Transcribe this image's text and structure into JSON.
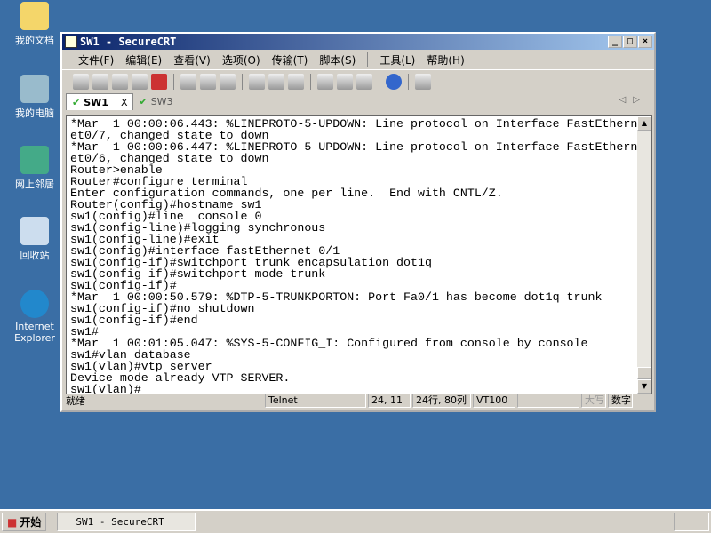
{
  "desktop": {
    "icons": [
      {
        "label": "我的文档"
      },
      {
        "label": "我的电脑"
      },
      {
        "label": "网上邻居"
      },
      {
        "label": "回收站"
      },
      {
        "label": "Internet Explorer"
      }
    ]
  },
  "window": {
    "title": "SW1 - SecureCRT",
    "menu": [
      "文件(F)",
      "编辑(E)",
      "查看(V)",
      "选项(O)",
      "传输(T)",
      "脚本(S)",
      "工具(L)",
      "帮助(H)"
    ],
    "tabs": [
      {
        "label": "SW1",
        "active": true,
        "close": "X"
      },
      {
        "label": "SW3",
        "active": false
      }
    ],
    "terminal_lines": [
      "*Mar  1 00:00:06.443: %LINEPROTO-5-UPDOWN: Line protocol on Interface FastEthern",
      "et0/7, changed state to down",
      "*Mar  1 00:00:06.447: %LINEPROTO-5-UPDOWN: Line protocol on Interface FastEthern",
      "et0/6, changed state to down",
      "Router>enable",
      "Router#configure terminal",
      "Enter configuration commands, one per line.  End with CNTL/Z.",
      "Router(config)#hostname sw1",
      "sw1(config)#line  console 0",
      "sw1(config-line)#logging synchronous",
      "sw1(config-line)#exit",
      "sw1(config)#interface fastEthernet 0/1",
      "sw1(config-if)#switchport trunk encapsulation dot1q",
      "sw1(config-if)#switchport mode trunk",
      "sw1(config-if)#",
      "*Mar  1 00:00:50.579: %DTP-5-TRUNKPORTON: Port Fa0/1 has become dot1q trunk",
      "sw1(config-if)#no shutdown",
      "sw1(config-if)#end",
      "sw1#",
      "*Mar  1 00:01:05.047: %SYS-5-CONFIG_I: Configured from console by console",
      "sw1#vlan database",
      "sw1(vlan)#vtp server",
      "Device mode already VTP SERVER.",
      "sw1(vlan)#"
    ],
    "status": {
      "ready": "就绪",
      "protocol": "Telnet",
      "cursor": "24, 11",
      "size": "24行, 80列",
      "emulation": "VT100",
      "blank": "",
      "caps": "大写",
      "num": "数字"
    }
  },
  "taskbar": {
    "start": "开始",
    "task": "SW1 - SecureCRT"
  }
}
